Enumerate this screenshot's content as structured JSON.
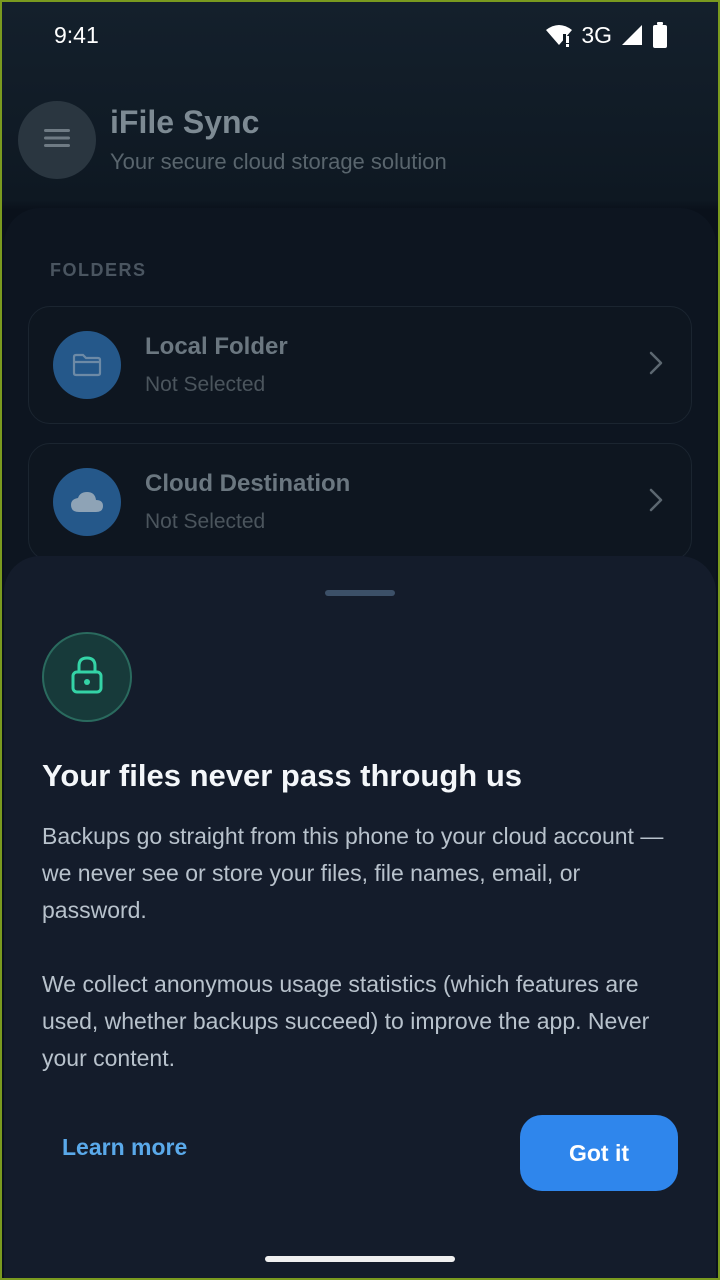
{
  "status_bar": {
    "time": "9:41",
    "network": "3G",
    "icons": [
      "wifi-icon",
      "signal-icon",
      "battery-icon"
    ]
  },
  "header": {
    "title": "iFile Sync",
    "subtitle": "Your secure cloud storage solution",
    "menu_icon": "menu-icon"
  },
  "folders": {
    "section_label": "FOLDERS",
    "items": [
      {
        "title": "Local Folder",
        "subtitle": "Not Selected",
        "icon": "folder-icon"
      },
      {
        "title": "Cloud Destination",
        "subtitle": "Not Selected",
        "icon": "cloud-icon"
      }
    ]
  },
  "sheet": {
    "icon": "lock-icon",
    "title": "Your files never pass through us",
    "paragraph1": "Backups go straight from this phone to your cloud account — we never see or store your files, file names, email, or password.",
    "paragraph2": "We collect anonymous usage statistics (which features are used, whether backups succeed) to improve the app. Never your content.",
    "learn_more": "Learn more",
    "primary_button": "Got it"
  },
  "colors": {
    "accent": "#2f86ec",
    "link": "#5aa9ea",
    "lock": "#34d3a6",
    "sheet_bg": "#141c2b"
  }
}
